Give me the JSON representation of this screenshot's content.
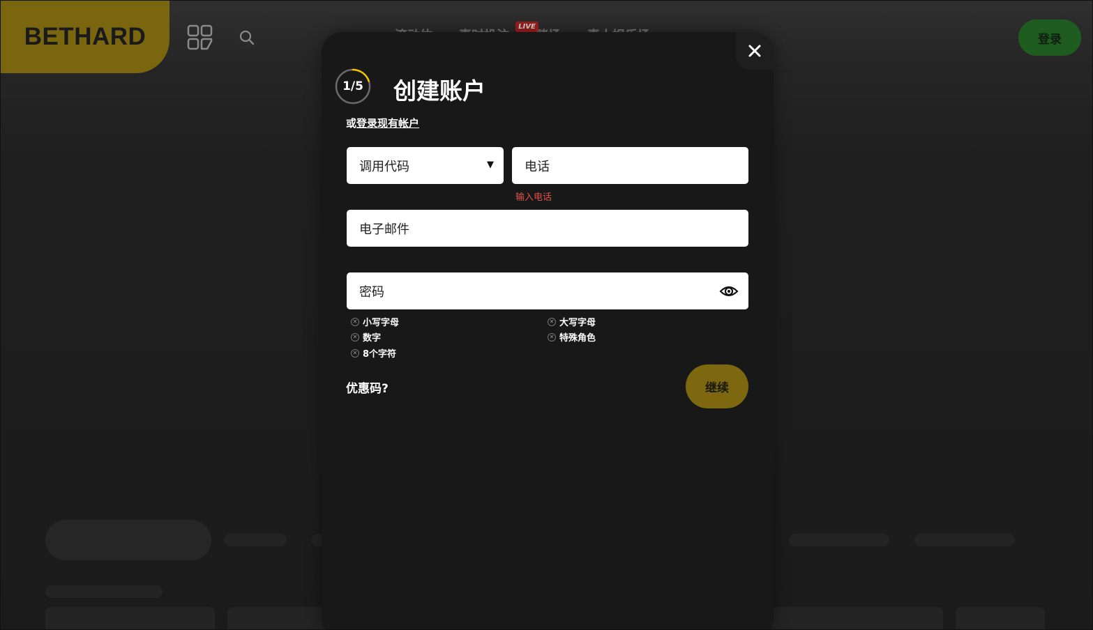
{
  "header": {
    "logo": "BETHARD",
    "nav_items": [
      "滚动体",
      "真时投注",
      "赌场",
      "真人娱乐场"
    ],
    "live_badge": "LIVE",
    "login_label": "登录"
  },
  "modal": {
    "step": "1/5",
    "step_progress": 0.2,
    "title": "创建账户",
    "login_prefix": "或",
    "login_link": "登录现有帐户",
    "calling_code": {
      "value": "调用代码"
    },
    "phone": {
      "placeholder": "电话",
      "error": "输入电话"
    },
    "email": {
      "placeholder": "电子邮件"
    },
    "password": {
      "placeholder": "密码"
    },
    "requirements": [
      "小写字母",
      "大写字母",
      "数字",
      "特殊角色",
      "8个字符"
    ],
    "promo_label": "优惠码?",
    "continue_label": "继续"
  },
  "colors": {
    "brand": "#7b6610",
    "login_button": "#1f5c1f",
    "error": "#e0524a",
    "progress_ring": "#f2c400"
  },
  "icons": [
    "grid-icon",
    "search-icon",
    "close-icon",
    "eye-icon",
    "x-circle-icon",
    "dropdown-caret-icon"
  ]
}
